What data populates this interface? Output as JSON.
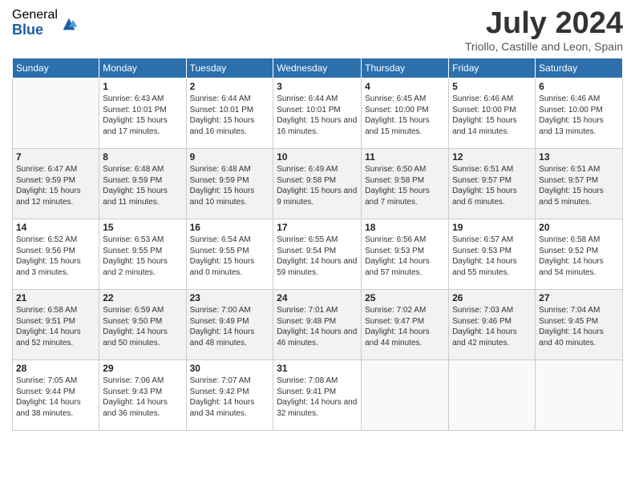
{
  "logo": {
    "general": "General",
    "blue": "Blue"
  },
  "title": "July 2024",
  "location": "Triollo, Castille and Leon, Spain",
  "days_of_week": [
    "Sunday",
    "Monday",
    "Tuesday",
    "Wednesday",
    "Thursday",
    "Friday",
    "Saturday"
  ],
  "weeks": [
    [
      {
        "day": "",
        "sunrise": "",
        "sunset": "",
        "daylight": ""
      },
      {
        "day": "1",
        "sunrise": "Sunrise: 6:43 AM",
        "sunset": "Sunset: 10:01 PM",
        "daylight": "Daylight: 15 hours and 17 minutes."
      },
      {
        "day": "2",
        "sunrise": "Sunrise: 6:44 AM",
        "sunset": "Sunset: 10:01 PM",
        "daylight": "Daylight: 15 hours and 16 minutes."
      },
      {
        "day": "3",
        "sunrise": "Sunrise: 6:44 AM",
        "sunset": "Sunset: 10:01 PM",
        "daylight": "Daylight: 15 hours and 16 minutes."
      },
      {
        "day": "4",
        "sunrise": "Sunrise: 6:45 AM",
        "sunset": "Sunset: 10:00 PM",
        "daylight": "Daylight: 15 hours and 15 minutes."
      },
      {
        "day": "5",
        "sunrise": "Sunrise: 6:46 AM",
        "sunset": "Sunset: 10:00 PM",
        "daylight": "Daylight: 15 hours and 14 minutes."
      },
      {
        "day": "6",
        "sunrise": "Sunrise: 6:46 AM",
        "sunset": "Sunset: 10:00 PM",
        "daylight": "Daylight: 15 hours and 13 minutes."
      }
    ],
    [
      {
        "day": "7",
        "sunrise": "Sunrise: 6:47 AM",
        "sunset": "Sunset: 9:59 PM",
        "daylight": "Daylight: 15 hours and 12 minutes."
      },
      {
        "day": "8",
        "sunrise": "Sunrise: 6:48 AM",
        "sunset": "Sunset: 9:59 PM",
        "daylight": "Daylight: 15 hours and 11 minutes."
      },
      {
        "day": "9",
        "sunrise": "Sunrise: 6:48 AM",
        "sunset": "Sunset: 9:59 PM",
        "daylight": "Daylight: 15 hours and 10 minutes."
      },
      {
        "day": "10",
        "sunrise": "Sunrise: 6:49 AM",
        "sunset": "Sunset: 9:58 PM",
        "daylight": "Daylight: 15 hours and 9 minutes."
      },
      {
        "day": "11",
        "sunrise": "Sunrise: 6:50 AM",
        "sunset": "Sunset: 9:58 PM",
        "daylight": "Daylight: 15 hours and 7 minutes."
      },
      {
        "day": "12",
        "sunrise": "Sunrise: 6:51 AM",
        "sunset": "Sunset: 9:57 PM",
        "daylight": "Daylight: 15 hours and 6 minutes."
      },
      {
        "day": "13",
        "sunrise": "Sunrise: 6:51 AM",
        "sunset": "Sunset: 9:57 PM",
        "daylight": "Daylight: 15 hours and 5 minutes."
      }
    ],
    [
      {
        "day": "14",
        "sunrise": "Sunrise: 6:52 AM",
        "sunset": "Sunset: 9:56 PM",
        "daylight": "Daylight: 15 hours and 3 minutes."
      },
      {
        "day": "15",
        "sunrise": "Sunrise: 6:53 AM",
        "sunset": "Sunset: 9:55 PM",
        "daylight": "Daylight: 15 hours and 2 minutes."
      },
      {
        "day": "16",
        "sunrise": "Sunrise: 6:54 AM",
        "sunset": "Sunset: 9:55 PM",
        "daylight": "Daylight: 15 hours and 0 minutes."
      },
      {
        "day": "17",
        "sunrise": "Sunrise: 6:55 AM",
        "sunset": "Sunset: 9:54 PM",
        "daylight": "Daylight: 14 hours and 59 minutes."
      },
      {
        "day": "18",
        "sunrise": "Sunrise: 6:56 AM",
        "sunset": "Sunset: 9:53 PM",
        "daylight": "Daylight: 14 hours and 57 minutes."
      },
      {
        "day": "19",
        "sunrise": "Sunrise: 6:57 AM",
        "sunset": "Sunset: 9:53 PM",
        "daylight": "Daylight: 14 hours and 55 minutes."
      },
      {
        "day": "20",
        "sunrise": "Sunrise: 6:58 AM",
        "sunset": "Sunset: 9:52 PM",
        "daylight": "Daylight: 14 hours and 54 minutes."
      }
    ],
    [
      {
        "day": "21",
        "sunrise": "Sunrise: 6:58 AM",
        "sunset": "Sunset: 9:51 PM",
        "daylight": "Daylight: 14 hours and 52 minutes."
      },
      {
        "day": "22",
        "sunrise": "Sunrise: 6:59 AM",
        "sunset": "Sunset: 9:50 PM",
        "daylight": "Daylight: 14 hours and 50 minutes."
      },
      {
        "day": "23",
        "sunrise": "Sunrise: 7:00 AM",
        "sunset": "Sunset: 9:49 PM",
        "daylight": "Daylight: 14 hours and 48 minutes."
      },
      {
        "day": "24",
        "sunrise": "Sunrise: 7:01 AM",
        "sunset": "Sunset: 9:48 PM",
        "daylight": "Daylight: 14 hours and 46 minutes."
      },
      {
        "day": "25",
        "sunrise": "Sunrise: 7:02 AM",
        "sunset": "Sunset: 9:47 PM",
        "daylight": "Daylight: 14 hours and 44 minutes."
      },
      {
        "day": "26",
        "sunrise": "Sunrise: 7:03 AM",
        "sunset": "Sunset: 9:46 PM",
        "daylight": "Daylight: 14 hours and 42 minutes."
      },
      {
        "day": "27",
        "sunrise": "Sunrise: 7:04 AM",
        "sunset": "Sunset: 9:45 PM",
        "daylight": "Daylight: 14 hours and 40 minutes."
      }
    ],
    [
      {
        "day": "28",
        "sunrise": "Sunrise: 7:05 AM",
        "sunset": "Sunset: 9:44 PM",
        "daylight": "Daylight: 14 hours and 38 minutes."
      },
      {
        "day": "29",
        "sunrise": "Sunrise: 7:06 AM",
        "sunset": "Sunset: 9:43 PM",
        "daylight": "Daylight: 14 hours and 36 minutes."
      },
      {
        "day": "30",
        "sunrise": "Sunrise: 7:07 AM",
        "sunset": "Sunset: 9:42 PM",
        "daylight": "Daylight: 14 hours and 34 minutes."
      },
      {
        "day": "31",
        "sunrise": "Sunrise: 7:08 AM",
        "sunset": "Sunset: 9:41 PM",
        "daylight": "Daylight: 14 hours and 32 minutes."
      },
      {
        "day": "",
        "sunrise": "",
        "sunset": "",
        "daylight": ""
      },
      {
        "day": "",
        "sunrise": "",
        "sunset": "",
        "daylight": ""
      },
      {
        "day": "",
        "sunrise": "",
        "sunset": "",
        "daylight": ""
      }
    ]
  ]
}
